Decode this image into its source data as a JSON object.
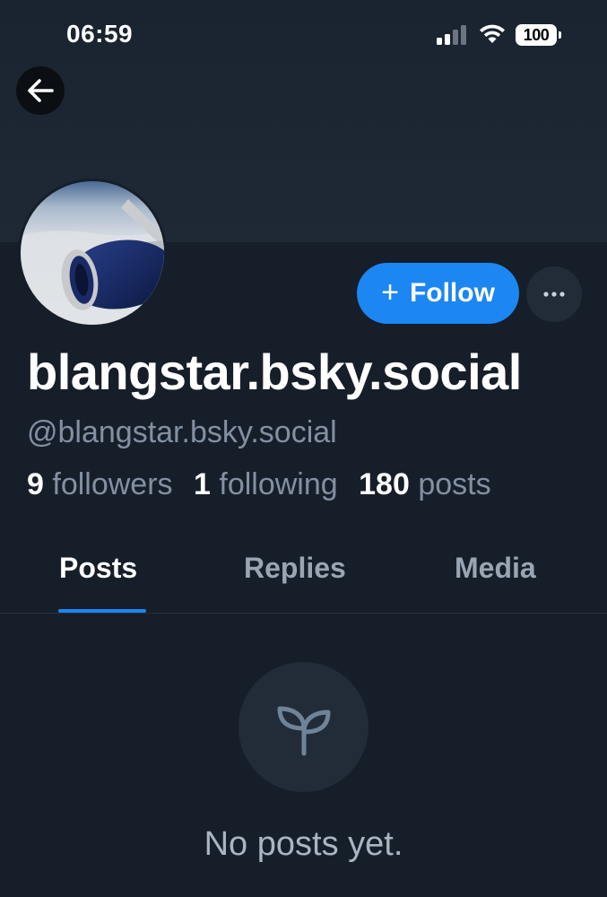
{
  "status_bar": {
    "time": "06:59",
    "battery": "100"
  },
  "profile": {
    "display_name": "blangstar.bsky.social",
    "handle": "@blangstar.bsky.social",
    "followers_count": "9",
    "followers_label": "followers",
    "following_count": "1",
    "following_label": "following",
    "posts_count": "180",
    "posts_label": "posts"
  },
  "actions": {
    "follow_plus": "+",
    "follow_label": "Follow"
  },
  "tabs": [
    {
      "label": "Posts",
      "active": true
    },
    {
      "label": "Replies",
      "active": false
    },
    {
      "label": "Media",
      "active": false
    }
  ],
  "empty_state": {
    "icon": "sprout-icon",
    "message": "No posts yet."
  },
  "colors": {
    "accent": "#1c86f2",
    "background": "#161e29",
    "muted_text": "#8390a2"
  }
}
